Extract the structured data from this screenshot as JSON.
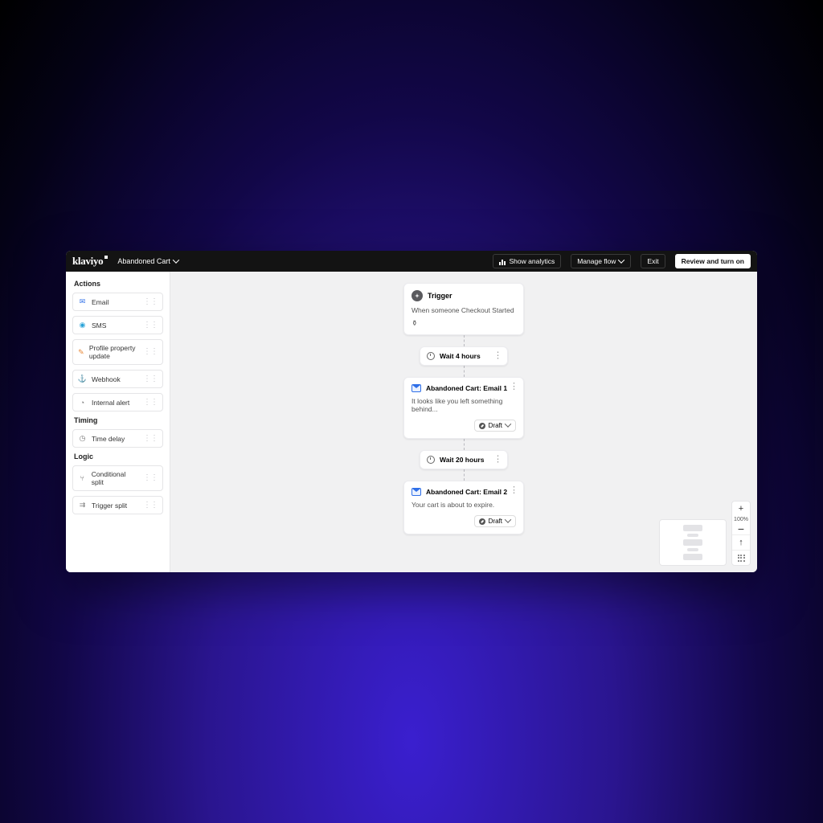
{
  "header": {
    "brand": "klaviyo",
    "flow_name": "Abandoned Cart",
    "show_analytics": "Show analytics",
    "manage_flow": "Manage flow",
    "exit": "Exit",
    "review": "Review and turn on"
  },
  "sidebar": {
    "sections": {
      "actions_title": "Actions",
      "timing_title": "Timing",
      "logic_title": "Logic"
    },
    "actions": [
      {
        "label": "Email",
        "icon": "✉",
        "color": "#2f6fe8"
      },
      {
        "label": "SMS",
        "icon": "◉",
        "color": "#2aa3d8"
      },
      {
        "label": "Profile property update",
        "icon": "✎",
        "color": "#e8893a"
      },
      {
        "label": "Webhook",
        "icon": "⚓",
        "color": "#d98a2b"
      },
      {
        "label": "Internal alert",
        "icon": "◔",
        "color": "#777"
      }
    ],
    "timing": [
      {
        "label": "Time delay",
        "icon": "◷",
        "color": "#777"
      }
    ],
    "logic": [
      {
        "label": "Conditional split",
        "icon": "⑂",
        "color": "#777"
      },
      {
        "label": "Trigger split",
        "icon": "⇉",
        "color": "#777"
      }
    ]
  },
  "flow": {
    "trigger": {
      "title": "Trigger",
      "subtitle": "When someone Checkout Started",
      "footer_icon": "filter"
    },
    "wait1": "Wait 4 hours",
    "email1": {
      "title": "Abandoned Cart: Email 1",
      "subtitle": "It looks like you left something behind...",
      "status": "Draft"
    },
    "wait2": "Wait 20 hours",
    "email2": {
      "title": "Abandoned Cart: Email 2",
      "subtitle": "Your cart is about to expire.",
      "status": "Draft"
    }
  },
  "zoom": {
    "level": "100%"
  }
}
